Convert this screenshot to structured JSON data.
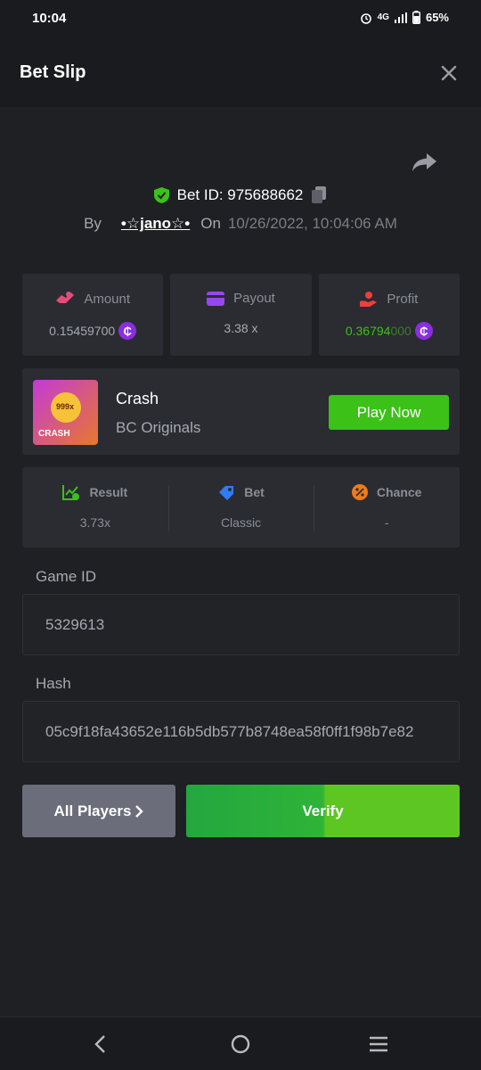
{
  "status_bar": {
    "time": "10:04",
    "network": "4G",
    "battery": "65%"
  },
  "header": {
    "title": "Bet Slip"
  },
  "bet": {
    "id_label": "Bet ID: 975688662",
    "by_label": "By",
    "username": "•☆jano☆•",
    "on_label": "On",
    "date": "10/26/2022, 10:04:06 AM"
  },
  "stats": {
    "amount": {
      "label": "Amount",
      "value_main": "0.15459700",
      "value_faded": ""
    },
    "payout": {
      "label": "Payout",
      "value": "3.38 x"
    },
    "profit": {
      "label": "Profit",
      "value_main": "0.36794",
      "value_faded": "000"
    }
  },
  "coin_symbol": "₵",
  "game": {
    "name": "Crash",
    "provider": "BC Originals",
    "thumb_label": "CRASH",
    "thumb_num": "999x",
    "play_label": "Play Now"
  },
  "results": {
    "result": {
      "label": "Result",
      "value": "3.73x"
    },
    "bet": {
      "label": "Bet",
      "value": "Classic"
    },
    "chance": {
      "label": "Chance",
      "value": "-"
    }
  },
  "game_id": {
    "label": "Game ID",
    "value": "5329613"
  },
  "hash": {
    "label": "Hash",
    "value": "05c9f18fa43652e116b5db577b8748ea58f0ff1f98b7e82"
  },
  "buttons": {
    "all_players": "All Players",
    "verify": "Verify"
  },
  "colors": {
    "accent_green": "#3bc117",
    "bg": "#1f2023",
    "card": "#2a2c31",
    "coin": "#8b2ee0"
  }
}
